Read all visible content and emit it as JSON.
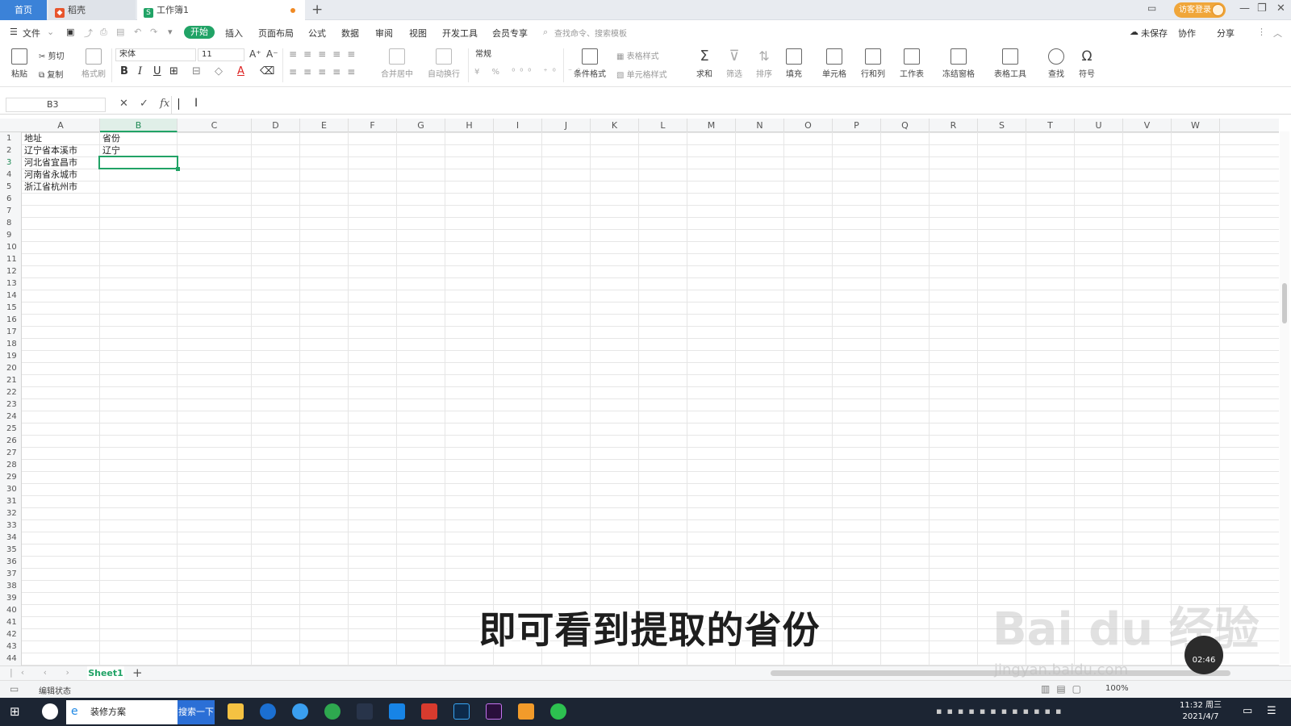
{
  "tabs": {
    "home": "首页",
    "docer": "稻壳",
    "workbook": "工作簿1",
    "new_tab": "+"
  },
  "titlebar": {
    "login": "访客登录",
    "minimize": "—",
    "restore": "❐",
    "close": "✕"
  },
  "menubar": {
    "file": "文件",
    "items": [
      "开始",
      "插入",
      "页面布局",
      "公式",
      "数据",
      "审阅",
      "视图",
      "开发工具",
      "会员专享"
    ],
    "search_placeholder": "查找命令、搜索模板",
    "unsaved": "未保存",
    "collaborate": "协作",
    "share": "分享"
  },
  "ribbon": {
    "paste": "粘贴",
    "cut": "剪切",
    "copy": "复制",
    "format_painter": "格式刷",
    "font_name": "宋体",
    "font_size": "11",
    "bold": "B",
    "italic": "I",
    "underline": "U",
    "merge_center": "合并居中",
    "auto_wrap": "自动换行",
    "number_format": "常规",
    "conditional_format": "条件格式",
    "table_style": "表格样式",
    "cell_style": "单元格样式",
    "sum": "求和",
    "filter": "筛选",
    "sort": "排序",
    "fill": "填充",
    "cell": "单元格",
    "row_col": "行和列",
    "worksheet": "工作表",
    "freeze": "冻结窗格",
    "table_tools": "表格工具",
    "find": "查找",
    "symbol": "符号"
  },
  "formula_bar": {
    "name_box": "B3",
    "cancel": "✕",
    "confirm": "✓",
    "fx": "fx",
    "value": ""
  },
  "grid": {
    "columns": [
      "A",
      "B",
      "C",
      "D",
      "E",
      "F",
      "G",
      "H",
      "I",
      "J",
      "K",
      "L",
      "M",
      "N",
      "O",
      "P",
      "Q",
      "R",
      "S",
      "T",
      "U",
      "V",
      "W"
    ],
    "selected_column": "B",
    "selected_row": 3,
    "rows": [
      "1",
      "2",
      "3",
      "4",
      "5",
      "6",
      "7",
      "8",
      "9",
      "10",
      "11",
      "12",
      "13",
      "14",
      "15",
      "16",
      "17",
      "18",
      "19",
      "20",
      "21",
      "22",
      "23",
      "24",
      "25",
      "26",
      "27",
      "28",
      "29",
      "30",
      "31",
      "32",
      "33",
      "34",
      "35",
      "36",
      "37",
      "38",
      "39",
      "40",
      "41",
      "42",
      "43",
      "44"
    ],
    "cells": {
      "A1": "地址",
      "A2": "辽宁省本溪市",
      "A3": "河北省宜昌市",
      "A4": "河南省永城市",
      "A5": "浙江省杭州市",
      "B1": "省份",
      "B2": "辽宁"
    }
  },
  "sheets": {
    "active": "Sheet1",
    "add": "+"
  },
  "status": {
    "mode": "编辑状态",
    "zoom": "100%"
  },
  "overlay": {
    "subtitle": "即可看到提取的省份",
    "watermark": "Bai du 经验",
    "watermark_url": "jingyan.baidu.com",
    "timer": "02:46"
  },
  "taskbar": {
    "search_text": "装修方案",
    "search_button": "搜索一下",
    "time": "11:32 周三",
    "date": "2021/4/7"
  }
}
